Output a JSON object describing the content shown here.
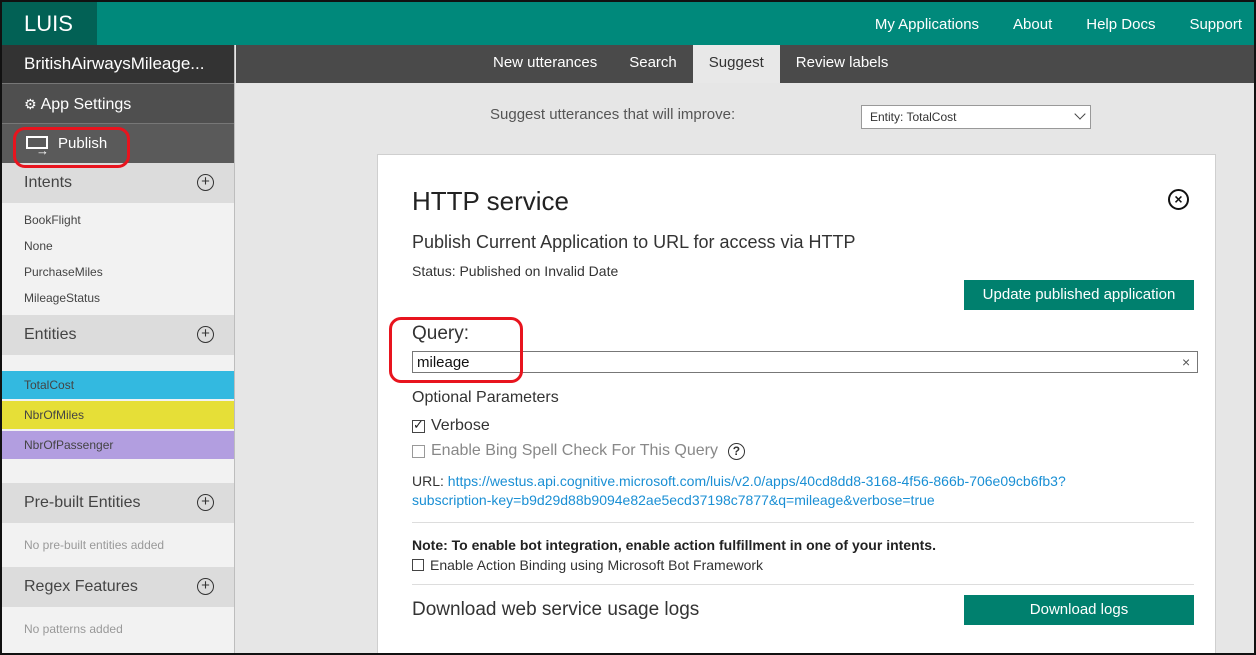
{
  "header": {
    "logo": "LUIS",
    "nav": [
      "My Applications",
      "About",
      "Help Docs",
      "Support"
    ]
  },
  "sidebar": {
    "app_name": "BritishAirwaysMileage...",
    "app_settings": "App Settings",
    "publish": "Publish",
    "intents": {
      "title": "Intents",
      "items": [
        "BookFlight",
        "None",
        "PurchaseMiles",
        "MileageStatus"
      ]
    },
    "entities": {
      "title": "Entities",
      "items": [
        {
          "label": "TotalCost",
          "color": "#33b9e0"
        },
        {
          "label": "NbrOfMiles",
          "color": "#e6df37"
        },
        {
          "label": "NbrOfPassenger",
          "color": "#b29ee0"
        }
      ]
    },
    "prebuilt": {
      "title": "Pre-built Entities",
      "empty": "No pre-built entities added"
    },
    "regex": {
      "title": "Regex Features",
      "empty": "No patterns added"
    }
  },
  "subnav": {
    "tabs": [
      "New utterances",
      "Search",
      "Suggest",
      "Review labels"
    ],
    "active": "Suggest"
  },
  "suggest": {
    "label": "Suggest utterances that will improve:",
    "selected": "Entity: TotalCost"
  },
  "panel": {
    "title": "HTTP service",
    "subtitle": "Publish Current Application to URL for access via HTTP",
    "status": "Status: Published on Invalid Date",
    "update_button": "Update published application",
    "query_label": "Query:",
    "query_value": "mileage",
    "clear_glyph": "×",
    "optional_label": "Optional Parameters",
    "verbose_label": "Verbose",
    "verbose_checked": true,
    "spell_label": "Enable Bing Spell Check For This Query",
    "spell_checked": false,
    "url_prefix": "URL:",
    "url_line1": "https://westus.api.cognitive.microsoft.com/luis/v2.0/apps/40cd8dd8-3168-4f56-866b-706e09cb6fb3?",
    "url_line2": "subscription-key=b9d29d88b9094e82ae5ecd37198c7877&q=mileage&verbose=true",
    "note": "Note: To enable bot integration, enable action fulfillment in one of your intents.",
    "action_binding_label": "Enable Action Binding using Microsoft Bot Framework",
    "download_label": "Download web service usage logs",
    "download_button": "Download logs"
  },
  "colors": {
    "brand": "#00897b",
    "button": "#00806e",
    "link": "#1a8fd4",
    "highlight": "#e8141e"
  }
}
